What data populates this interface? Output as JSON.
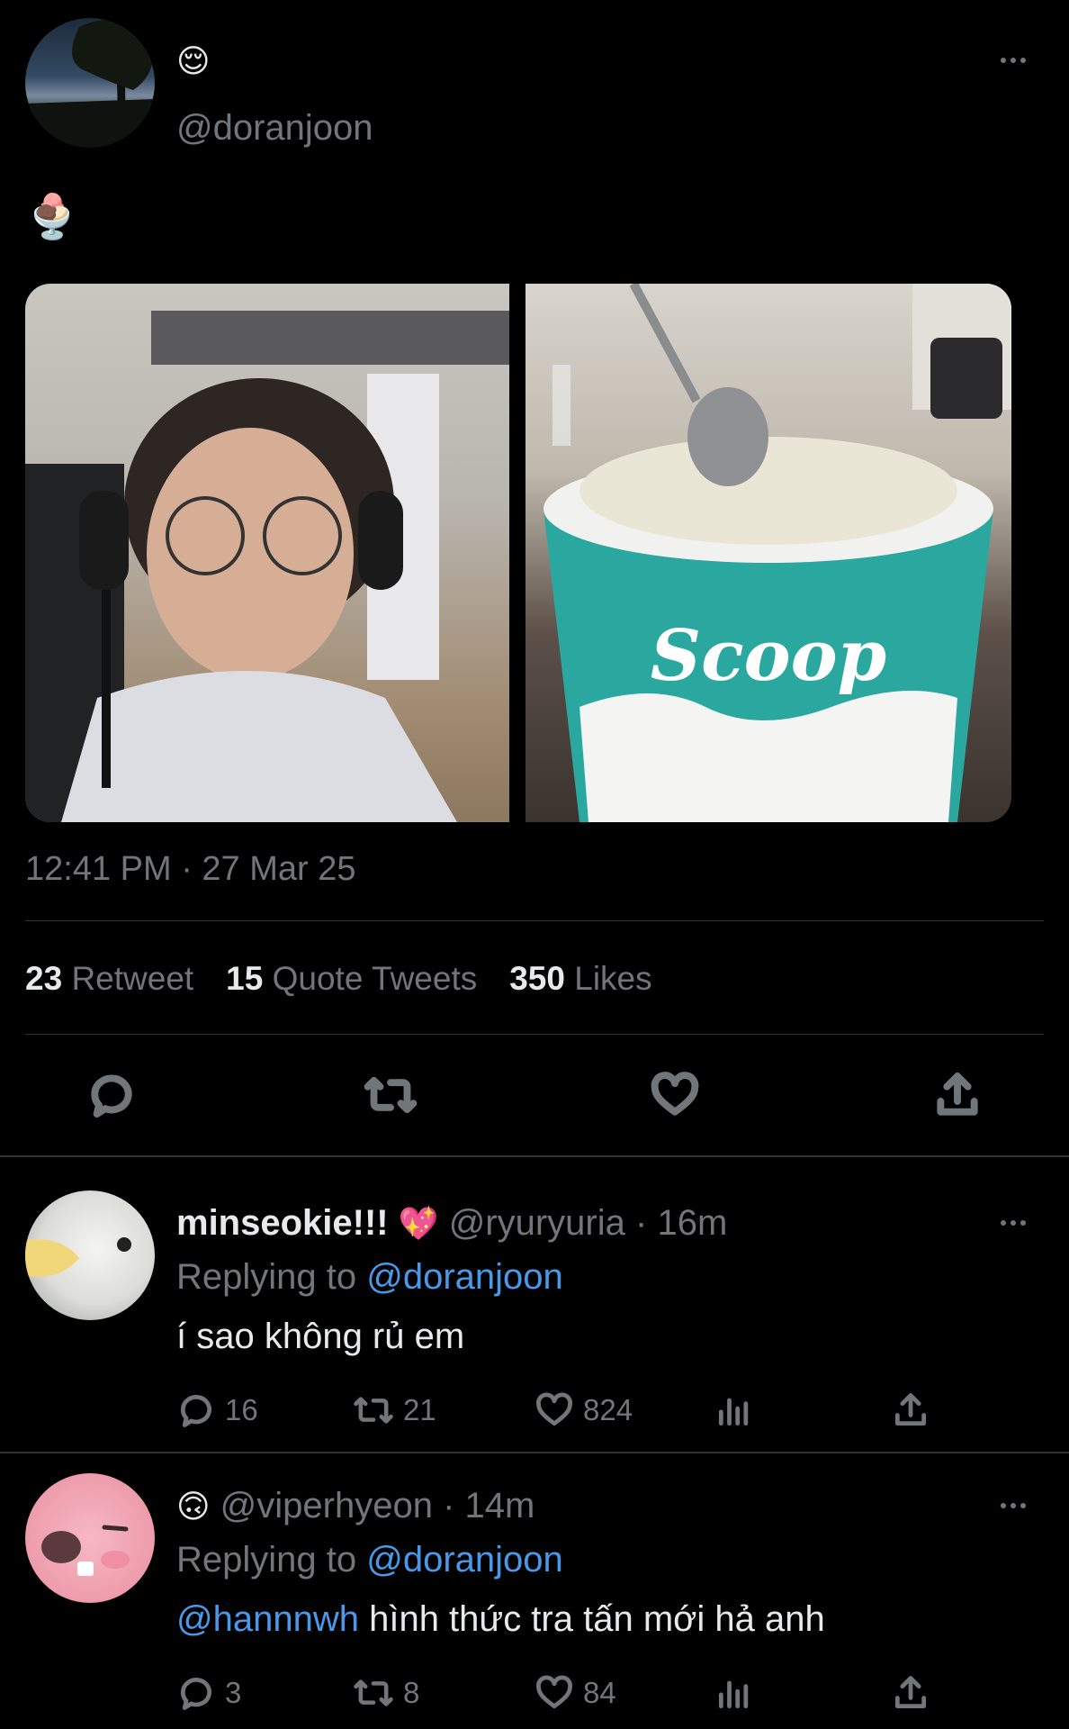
{
  "main_tweet": {
    "name_emoji": "😌",
    "handle": "@doranjoon",
    "body_emoji": "🍨",
    "timestamp": "12:41 PM · 27 Mar 25",
    "stats": {
      "retweets_count": "23",
      "retweets_label": "Retweet",
      "quotes_count": "15",
      "quotes_label": "Quote Tweets",
      "likes_count": "350",
      "likes_label": "Likes"
    },
    "photo2_text": "Scoop"
  },
  "replies": [
    {
      "display_name": "minseokie!!!",
      "name_emoji": "💖",
      "handle": "@ryuryuria",
      "time": "· 16m",
      "replying_label": "Replying to",
      "replying_handle": "@doranjoon",
      "text_mention": "",
      "text": "í sao không rủ em",
      "replies": "16",
      "retweets": "21",
      "likes": "824"
    },
    {
      "display_name": "",
      "name_emoji": "🙃",
      "handle": "@viperhyeon",
      "time": "· 14m",
      "replying_label": "Replying to",
      "replying_handle": "@doranjoon",
      "text_mention": "@hannnwh",
      "text": "hình thức tra tấn mới hả anh",
      "replies": "3",
      "retweets": "8",
      "likes": "84"
    }
  ],
  "colors": {
    "background": "#000000",
    "text": "#e7e9ea",
    "muted": "#71767b",
    "link": "#4a99e9",
    "divider": "#2f3336",
    "cup": "#2aa8a0"
  }
}
